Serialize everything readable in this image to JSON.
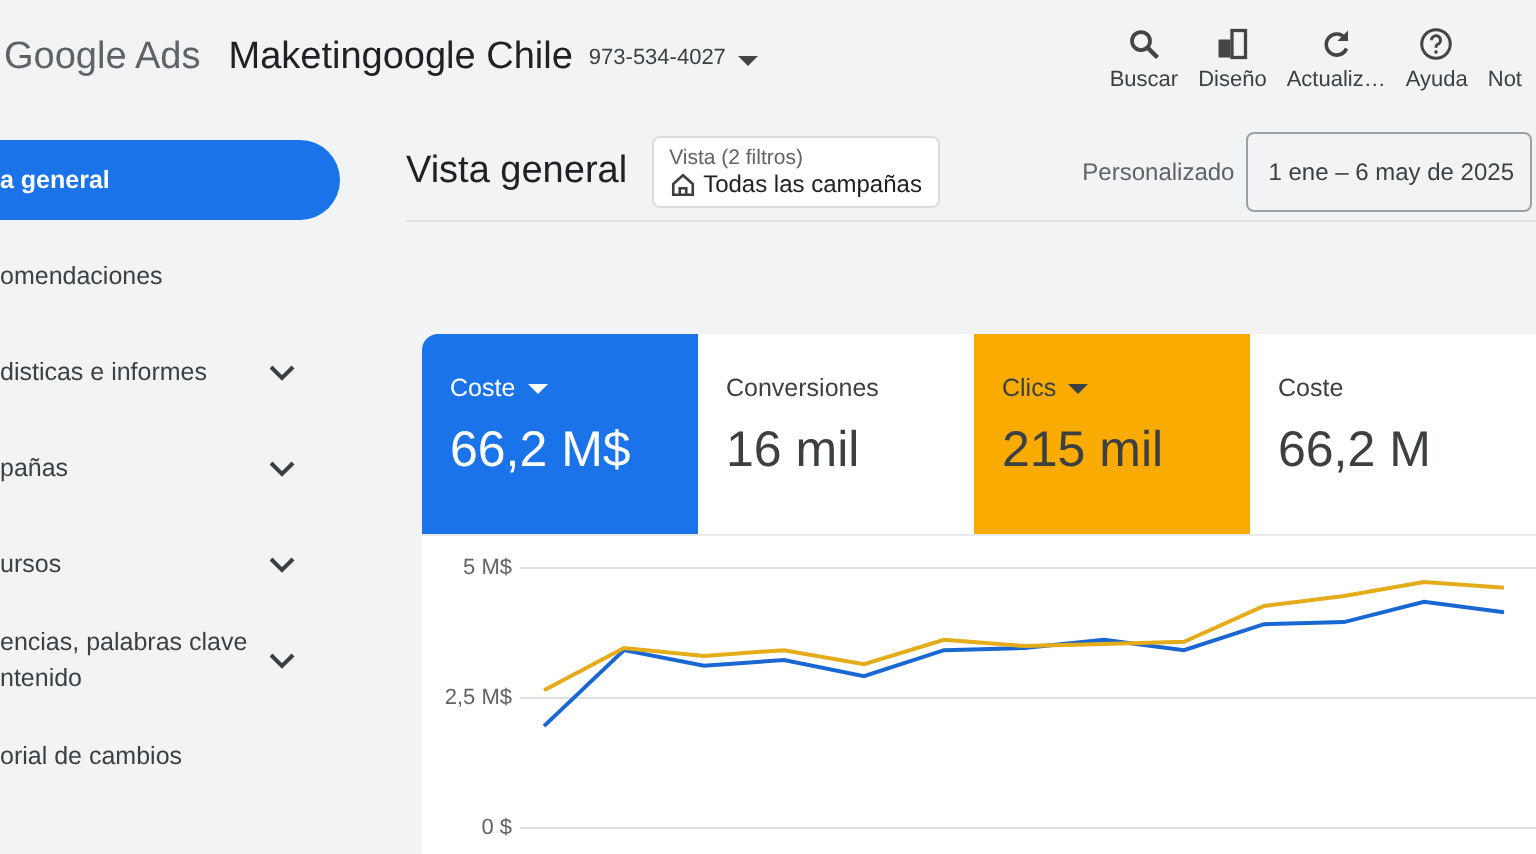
{
  "header": {
    "product": "Google Ads",
    "account": "Maketingoogle Chile",
    "account_id": "973-534-4027"
  },
  "toolbar": [
    {
      "label": "Buscar"
    },
    {
      "label": "Diseño"
    },
    {
      "label": "Actualiz…"
    },
    {
      "label": "Ayuda"
    },
    {
      "label": "Not"
    }
  ],
  "sidebar": {
    "items": [
      {
        "label": "a general",
        "selected": true,
        "expandable": false
      },
      {
        "label": "omendaciones",
        "selected": false,
        "expandable": false
      },
      {
        "label": "disticas e informes",
        "selected": false,
        "expandable": true
      },
      {
        "label": "pañas",
        "selected": false,
        "expandable": true
      },
      {
        "label": "ursos",
        "selected": false,
        "expandable": true
      },
      {
        "label": "encias, palabras clave ntenido",
        "selected": false,
        "expandable": true
      },
      {
        "label": "orial de cambios",
        "selected": false,
        "expandable": false
      }
    ]
  },
  "page": {
    "title": "Vista general",
    "view": {
      "label": "Vista (2 filtros)",
      "value": "Todas las campañas"
    },
    "date_label": "Personalizado",
    "date_range": "1 ene – 6 may de 2025"
  },
  "metrics": [
    {
      "name": "Coste",
      "value": "66,2 M$",
      "selected": true,
      "color": "#1a73e8"
    },
    {
      "name": "Conversiones",
      "value": "16 mil",
      "selected": false,
      "color": "#ffffff"
    },
    {
      "name": "Clics",
      "value": "215 mil",
      "selected": true,
      "color": "#f9ab00"
    },
    {
      "name": "Coste",
      "value": "66,2 M",
      "selected": false,
      "color": "#ffffff"
    }
  ],
  "chart_data": {
    "type": "line",
    "ylim": [
      0,
      5
    ],
    "yticks": [
      {
        "value": 0,
        "label": "0 $"
      },
      {
        "value": 2.5,
        "label": "2,5 M$"
      },
      {
        "value": 5,
        "label": "5 M$"
      }
    ],
    "series": [
      {
        "color": "#1967d2",
        "values": [
          1.96,
          3.42,
          3.12,
          3.23,
          2.92,
          3.42,
          3.46,
          3.62,
          3.42,
          3.92,
          3.96,
          4.35,
          4.15
        ]
      },
      {
        "color": "#e5ac1a",
        "values": [
          2.65,
          3.46,
          3.31,
          3.42,
          3.15,
          3.62,
          3.5,
          3.54,
          3.58,
          4.27,
          4.46,
          4.73,
          4.62
        ]
      }
    ]
  }
}
